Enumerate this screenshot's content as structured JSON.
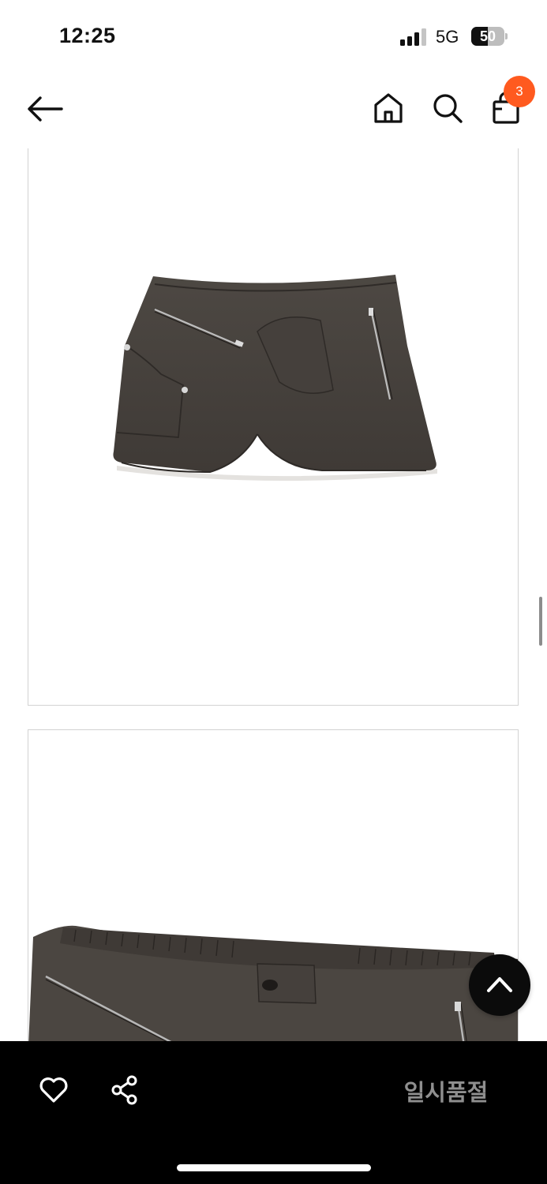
{
  "status_bar": {
    "time": "12:25",
    "network": "5G",
    "battery": "50",
    "battery_level": 0.5
  },
  "nav": {
    "cart_count": "3",
    "icons": [
      "back-arrow-icon",
      "home-icon",
      "search-icon",
      "shopping-bag-icon"
    ]
  },
  "images": [
    {
      "subject": "dark brown mini skirt with zipper pockets, front view"
    },
    {
      "subject": "dark brown mini skirt waistband, close-up view"
    }
  ],
  "bottom_bar": {
    "soldout_label": "일시품절",
    "icons": [
      "heart-icon",
      "share-icon"
    ]
  },
  "colors": {
    "badge": "#ff5a1f",
    "bottom_bar": "#000000",
    "soldout_text": "#8f8f8f",
    "skirt": "#4a4540"
  }
}
